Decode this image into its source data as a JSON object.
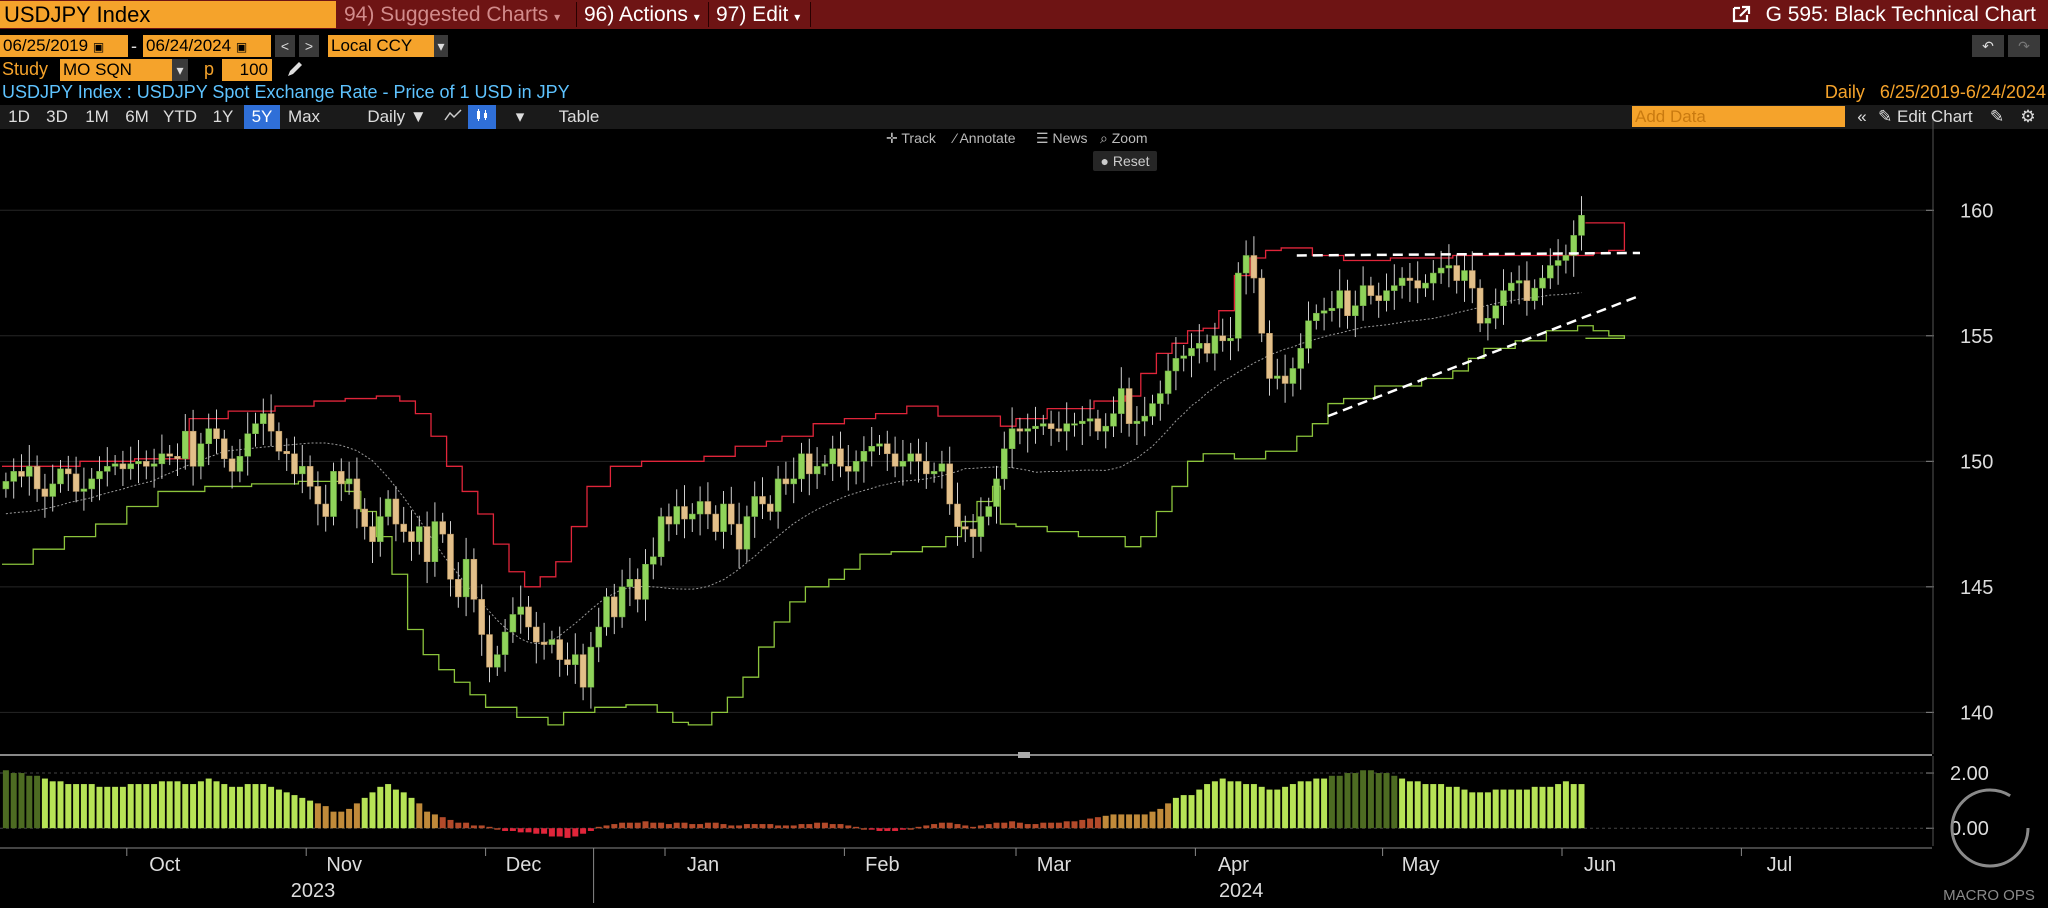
{
  "header": {
    "ticker": "USDJPY Index",
    "menu": [
      {
        "label": "94) Suggested Charts",
        "dim": true
      },
      {
        "label": "96) Actions",
        "dim": false
      },
      {
        "label": "97) Edit",
        "dim": false
      }
    ],
    "right_title": "G 595: Black Technical Chart"
  },
  "controls": {
    "start_date": "06/25/2019",
    "date_dash": "-",
    "end_date": "06/24/2024",
    "currency": "Local CCY",
    "study_label": "Study",
    "study_value": "MO SQN",
    "p_label": "p",
    "p_value": "100"
  },
  "security_title": "USDJPY Index : USDJPY Spot Exchange Rate - Price of 1 USD in JPY",
  "period_text": "Daily",
  "range_text": "6/25/2019-6/24/2024",
  "timeframes": [
    "1D",
    "3D",
    "1M",
    "6M",
    "YTD",
    "1Y",
    "5Y",
    "Max"
  ],
  "active_timeframe": "5Y",
  "frequency": "Daily ▼",
  "table_label": "Table",
  "add_data_placeholder": "Add Data",
  "edit_chart_label": "Edit Chart",
  "tools": [
    "Track",
    "Annotate",
    "News",
    "Zoom"
  ],
  "reset_label": "Reset",
  "chart_data": {
    "type": "candlestick",
    "ylim": [
      138.5,
      162.8
    ],
    "y_ticks": [
      140,
      145,
      150,
      155,
      160
    ],
    "months": [
      {
        "label": "Oct",
        "idx": 16
      },
      {
        "label": "Nov",
        "idx": 39
      },
      {
        "label": "Dec",
        "idx": 62
      },
      {
        "label": "Jan",
        "idx": 85
      },
      {
        "label": "Feb",
        "idx": 108
      },
      {
        "label": "Mar",
        "idx": 130
      },
      {
        "label": "Apr",
        "idx": 153
      },
      {
        "label": "May",
        "idx": 177
      },
      {
        "label": "Jun",
        "idx": 200
      },
      {
        "label": "Jul",
        "idx": 223
      }
    ],
    "years": [
      {
        "label": "2023",
        "idx": 35
      },
      {
        "label": "2024",
        "idx": 154
      }
    ],
    "year_divider_idx": 72,
    "total_slots": 247,
    "close": [
      149.2,
      149.6,
      149.4,
      149.8,
      148.9,
      148.6,
      149.1,
      149.7,
      149.5,
      148.8,
      148.9,
      149.3,
      149.6,
      149.8,
      149.9,
      149.7,
      149.9,
      150.0,
      149.8,
      149.9,
      150.3,
      150.2,
      150.1,
      151.2,
      149.8,
      150.7,
      151.3,
      150.9,
      150.1,
      149.6,
      150.2,
      151.1,
      151.5,
      151.9,
      151.2,
      150.4,
      150.3,
      149.5,
      149.8,
      149.0,
      148.3,
      147.8,
      149.6,
      149.1,
      149.3,
      148.1,
      147.4,
      146.8,
      147.8,
      148.5,
      147.5,
      147.2,
      146.8,
      147.4,
      146.0,
      147.6,
      147.1,
      145.3,
      144.6,
      146.1,
      144.5,
      143.1,
      141.8,
      142.3,
      143.2,
      143.9,
      144.2,
      143.4,
      142.8,
      142.7,
      142.9,
      142.1,
      141.9,
      142.3,
      141.0,
      142.6,
      143.4,
      144.6,
      143.8,
      145.0,
      145.3,
      144.5,
      145.9,
      146.2,
      147.8,
      147.5,
      148.2,
      147.7,
      147.9,
      148.4,
      147.9,
      147.2,
      148.3,
      147.5,
      146.5,
      147.8,
      148.6,
      148.3,
      148.0,
      149.3,
      149.1,
      149.3,
      150.3,
      149.5,
      149.8,
      149.9,
      150.5,
      149.8,
      149.6,
      150.0,
      150.4,
      150.6,
      150.7,
      150.3,
      149.8,
      150.0,
      150.3,
      150.0,
      149.5,
      149.6,
      149.9,
      148.3,
      147.4,
      147.3,
      147.0,
      147.8,
      148.2,
      149.3,
      150.5,
      151.3,
      151.2,
      151.3,
      151.4,
      151.5,
      151.3,
      151.2,
      151.5,
      151.5,
      151.6,
      151.7,
      151.2,
      151.4,
      151.9,
      152.9,
      151.5,
      151.6,
      151.8,
      152.3,
      152.7,
      153.6,
      154.1,
      154.2,
      154.5,
      154.7,
      154.3,
      155.0,
      154.8,
      154.9,
      157.5,
      158.2,
      157.3,
      155.1,
      153.3,
      153.4,
      153.1,
      153.7,
      154.5,
      155.6,
      155.9,
      156.0,
      156.1,
      156.8,
      155.8,
      156.2,
      157.0,
      156.6,
      156.4,
      156.8,
      157.0,
      157.3,
      157.2,
      156.9,
      157.1,
      157.5,
      157.7,
      157.8,
      157.2,
      157.6,
      156.9,
      155.5,
      155.7,
      156.2,
      156.8,
      157.1,
      157.2,
      156.4,
      156.9,
      157.3,
      157.8,
      158.0,
      158.2,
      159.0,
      159.8
    ],
    "bollinger_upper_steps": [
      [
        0,
        149.8
      ],
      [
        10,
        150.0
      ],
      [
        17,
        150.1
      ],
      [
        24,
        151.7
      ],
      [
        29,
        152.0
      ],
      [
        35,
        152.2
      ],
      [
        40,
        152.4
      ],
      [
        44,
        152.5
      ],
      [
        48,
        152.6
      ],
      [
        51,
        152.4
      ],
      [
        53,
        151.9
      ],
      [
        55,
        151.0
      ],
      [
        57,
        149.8
      ],
      [
        59,
        148.8
      ],
      [
        61,
        147.9
      ],
      [
        63,
        146.7
      ],
      [
        65,
        145.6
      ],
      [
        67,
        145.0
      ],
      [
        69,
        145.4
      ],
      [
        71,
        146.0
      ],
      [
        73,
        147.4
      ],
      [
        75,
        149.0
      ],
      [
        78,
        149.8
      ],
      [
        82,
        150.0
      ],
      [
        86,
        150.0
      ],
      [
        90,
        150.2
      ],
      [
        94,
        150.6
      ],
      [
        98,
        150.8
      ],
      [
        100,
        151.0
      ],
      [
        104,
        151.5
      ],
      [
        108,
        151.7
      ],
      [
        112,
        151.9
      ],
      [
        116,
        152.2
      ],
      [
        120,
        151.8
      ],
      [
        124,
        151.8
      ],
      [
        128,
        151.4
      ],
      [
        130,
        151.7
      ],
      [
        134,
        152.1
      ],
      [
        140,
        152.4
      ],
      [
        144,
        152.6
      ],
      [
        146,
        153.5
      ],
      [
        148,
        154.3
      ],
      [
        150,
        154.7
      ],
      [
        152,
        155.2
      ],
      [
        154,
        155.3
      ],
      [
        156,
        156.0
      ],
      [
        158,
        157.4
      ],
      [
        160,
        158.1
      ],
      [
        162,
        158.4
      ],
      [
        164,
        158.5
      ],
      [
        168,
        158.2
      ],
      [
        172,
        158.0
      ],
      [
        178,
        158.1
      ],
      [
        186,
        158.2
      ],
      [
        194,
        158.2
      ],
      [
        204,
        158.3
      ],
      [
        206,
        158.4
      ],
      [
        208,
        159.5
      ]
    ],
    "bollinger_lower_steps": [
      [
        0,
        145.9
      ],
      [
        4,
        146.5
      ],
      [
        8,
        147.0
      ],
      [
        12,
        147.5
      ],
      [
        16,
        148.2
      ],
      [
        20,
        148.8
      ],
      [
        26,
        149.0
      ],
      [
        32,
        149.1
      ],
      [
        38,
        149.2
      ],
      [
        44,
        148.8
      ],
      [
        46,
        148.0
      ],
      [
        48,
        147.0
      ],
      [
        50,
        145.5
      ],
      [
        52,
        143.3
      ],
      [
        54,
        142.3
      ],
      [
        56,
        141.7
      ],
      [
        58,
        141.2
      ],
      [
        60,
        140.7
      ],
      [
        62,
        140.2
      ],
      [
        66,
        139.8
      ],
      [
        70,
        139.5
      ],
      [
        72,
        140.0
      ],
      [
        76,
        140.2
      ],
      [
        80,
        140.3
      ],
      [
        84,
        140.0
      ],
      [
        86,
        139.6
      ],
      [
        88,
        139.5
      ],
      [
        91,
        140.0
      ],
      [
        93,
        140.6
      ],
      [
        95,
        141.4
      ],
      [
        97,
        142.6
      ],
      [
        99,
        143.6
      ],
      [
        101,
        144.4
      ],
      [
        103,
        145.0
      ],
      [
        106,
        145.3
      ],
      [
        108,
        145.7
      ],
      [
        110,
        146.3
      ],
      [
        114,
        146.4
      ],
      [
        118,
        146.6
      ],
      [
        121,
        147.0
      ],
      [
        123,
        147.6
      ],
      [
        125,
        148.4
      ],
      [
        127,
        149.0
      ],
      [
        128,
        147.5
      ],
      [
        130,
        147.4
      ],
      [
        134,
        147.2
      ],
      [
        138,
        147.0
      ],
      [
        144,
        146.6
      ],
      [
        146,
        147.0
      ],
      [
        148,
        148.0
      ],
      [
        150,
        149.0
      ],
      [
        152,
        150.0
      ],
      [
        154,
        150.3
      ],
      [
        158,
        150.1
      ],
      [
        162,
        150.4
      ],
      [
        166,
        151.0
      ],
      [
        168,
        151.5
      ],
      [
        170,
        152.3
      ],
      [
        172,
        152.5
      ],
      [
        176,
        153.0
      ],
      [
        182,
        153.3
      ],
      [
        186,
        153.6
      ],
      [
        188,
        154.1
      ],
      [
        190,
        154.5
      ],
      [
        194,
        154.8
      ],
      [
        198,
        155.2
      ],
      [
        202,
        155.4
      ],
      [
        204,
        155.2
      ],
      [
        206,
        155.0
      ],
      [
        208,
        154.9
      ]
    ],
    "trendlines": [
      {
        "from": [
          166,
          158.2
        ],
        "to": [
          210,
          158.3
        ],
        "color": "#ffffff"
      },
      {
        "from": [
          170,
          151.8
        ],
        "to": [
          210,
          156.6
        ],
        "color": "#ffffff"
      }
    ],
    "oscillator": {
      "ylim": [
        -0.5,
        2.4
      ],
      "ticks": [
        2.0,
        0.0
      ],
      "values": [
        2.1,
        2.0,
        2.0,
        1.9,
        1.9,
        1.8,
        1.7,
        1.7,
        1.6,
        1.6,
        1.6,
        1.6,
        1.5,
        1.5,
        1.5,
        1.5,
        1.6,
        1.6,
        1.6,
        1.6,
        1.7,
        1.7,
        1.7,
        1.6,
        1.6,
        1.7,
        1.8,
        1.7,
        1.6,
        1.5,
        1.5,
        1.6,
        1.6,
        1.6,
        1.5,
        1.4,
        1.3,
        1.2,
        1.1,
        1.0,
        0.9,
        0.8,
        0.6,
        0.6,
        0.7,
        0.9,
        1.1,
        1.3,
        1.5,
        1.6,
        1.4,
        1.3,
        1.1,
        0.9,
        0.6,
        0.5,
        0.4,
        0.3,
        0.2,
        0.2,
        0.1,
        0.1,
        0.05,
        0.0,
        -0.1,
        -0.1,
        -0.15,
        -0.15,
        -0.2,
        -0.2,
        -0.3,
        -0.3,
        -0.35,
        -0.3,
        -0.2,
        -0.1,
        0.05,
        0.1,
        0.15,
        0.2,
        0.2,
        0.2,
        0.25,
        0.2,
        0.2,
        0.15,
        0.2,
        0.2,
        0.15,
        0.15,
        0.2,
        0.2,
        0.15,
        0.1,
        0.1,
        0.15,
        0.15,
        0.15,
        0.15,
        0.1,
        0.1,
        0.1,
        0.15,
        0.15,
        0.2,
        0.2,
        0.15,
        0.15,
        0.1,
        0.05,
        0.0,
        -0.05,
        -0.1,
        -0.1,
        -0.1,
        -0.05,
        0.0,
        0.05,
        0.1,
        0.15,
        0.2,
        0.2,
        0.15,
        0.1,
        0.05,
        0.1,
        0.15,
        0.2,
        0.2,
        0.25,
        0.2,
        0.15,
        0.15,
        0.2,
        0.2,
        0.2,
        0.25,
        0.25,
        0.3,
        0.35,
        0.4,
        0.45,
        0.5,
        0.5,
        0.5,
        0.5,
        0.5,
        0.6,
        0.7,
        0.9,
        1.1,
        1.2,
        1.2,
        1.4,
        1.6,
        1.7,
        1.8,
        1.7,
        1.7,
        1.6,
        1.6,
        1.5,
        1.4,
        1.4,
        1.5,
        1.6,
        1.7,
        1.7,
        1.8,
        1.8,
        1.9,
        1.9,
        2.0,
        2.0,
        2.1,
        2.1,
        2.0,
        2.0,
        1.9,
        1.8,
        1.7,
        1.7,
        1.6,
        1.6,
        1.6,
        1.5,
        1.5,
        1.4,
        1.3,
        1.3,
        1.3,
        1.4,
        1.4,
        1.4,
        1.4,
        1.4,
        1.5,
        1.5,
        1.5,
        1.6,
        1.7,
        1.6,
        1.6
      ]
    }
  },
  "watermark": "MACRO OPS"
}
